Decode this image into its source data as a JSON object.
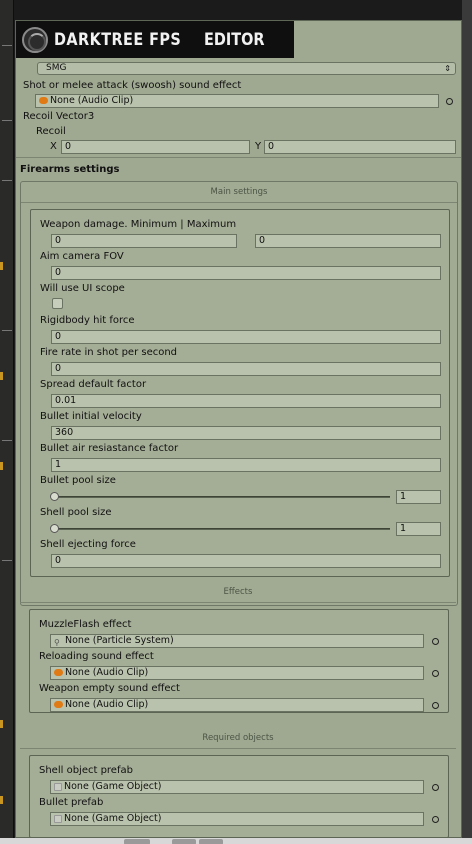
{
  "header": {
    "title": "DARKTREE FPS",
    "editor_label": "EDITOR"
  },
  "weapon_type": {
    "selected": "SMG"
  },
  "attack_sound": {
    "label": "Shot or melee attack (swoosh) sound effect",
    "value": "None (Audio Clip)"
  },
  "recoil": {
    "section_label": "Recoil Vector3",
    "label": "Recoil",
    "x_label": "X",
    "x_value": "0",
    "y_label": "Y",
    "y_value": "0"
  },
  "firearms": {
    "title": "Firearms settings",
    "main_caption": "Main settings",
    "damage": {
      "label": "Weapon damage. Minimum | Maximum",
      "min": "0",
      "max": "0"
    },
    "fov": {
      "label": "Aim camera FOV",
      "value": "0"
    },
    "ui_scope": {
      "label": "Will use UI scope",
      "checked": false
    },
    "hit_force": {
      "label": "Rigidbody hit force",
      "value": "0"
    },
    "fire_rate": {
      "label": "Fire rate in shot per second",
      "value": "0"
    },
    "spread": {
      "label": "Spread default factor",
      "value": "0.01"
    },
    "velocity": {
      "label": "Bullet initial velocity",
      "value": "360"
    },
    "air_resistance": {
      "label": "Bullet air resiastance factor",
      "value": "1"
    },
    "bullet_pool": {
      "label": "Bullet pool size",
      "value": "1"
    },
    "shell_pool": {
      "label": "Shell pool size",
      "value": "1"
    },
    "shell_force": {
      "label": "Shell ejecting force",
      "value": "0"
    }
  },
  "effects": {
    "caption": "Effects",
    "muzzle": {
      "label": "MuzzleFlash effect",
      "value": "None (Particle System)"
    },
    "reload": {
      "label": "Reloading sound effect",
      "value": "None (Audio Clip)"
    },
    "empty": {
      "label": "Weapon empty sound effect",
      "value": "None (Audio Clip)"
    }
  },
  "required": {
    "caption": "Required objects",
    "shell": {
      "label": "Shell object prefab",
      "value": "None (Game Object)"
    },
    "bullet": {
      "label": "Bullet prefab",
      "value": "None (Game Object)"
    }
  },
  "colors": {
    "panel": "#9fa891",
    "header": "#0f0f0f",
    "audio_icon": "#e07a14"
  }
}
